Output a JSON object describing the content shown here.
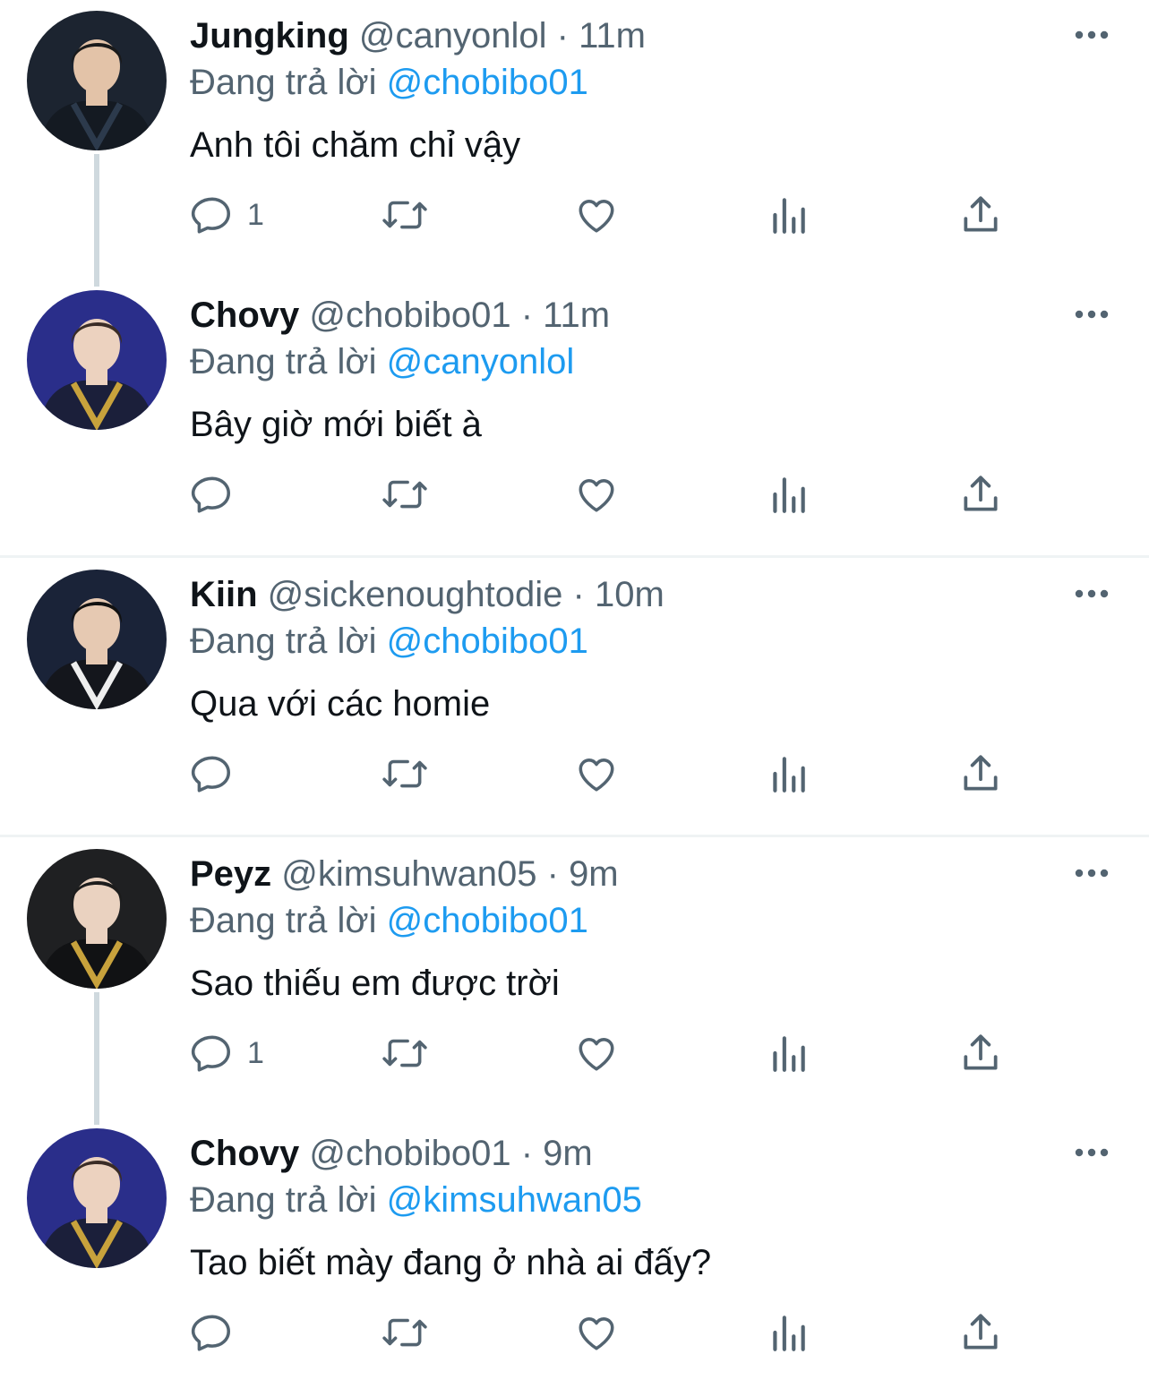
{
  "labels": {
    "replying_to": "Đang trả lời",
    "dot": "·"
  },
  "colors": {
    "mention": "#1d9bf0",
    "secondary": "#536471",
    "thread_line": "#cfd9de",
    "divider": "#eff3f4"
  },
  "icons": [
    "reply-icon",
    "retweet-icon",
    "like-icon",
    "views-icon",
    "share-icon",
    "more-icon"
  ],
  "tweets": [
    {
      "name": "Jungking",
      "handle": "@canyonlol",
      "time": "11m",
      "reply_to": "@chobibo01",
      "text": "Anh tôi chăm chỉ vậy",
      "reply_count": "1",
      "avatar": {
        "bg": "#1c2430",
        "jersey": "#141a22",
        "skin": "#e3c3a8",
        "hair": "#1a1a1a",
        "accent": "#2c3a4c"
      }
    },
    {
      "name": "Chovy",
      "handle": "@chobibo01",
      "time": "11m",
      "reply_to": "@canyonlol",
      "text": "Bây giờ mới biết à",
      "reply_count": "",
      "avatar": {
        "bg": "#2a2e8a",
        "jersey": "#1b1f3a",
        "skin": "#ecd2bf",
        "hair": "#3a2c26",
        "accent": "#c8a23c"
      }
    },
    {
      "name": "Kiin",
      "handle": "@sickenoughtodie",
      "time": "10m",
      "reply_to": "@chobibo01",
      "text": "Qua với các homie",
      "reply_count": "",
      "avatar": {
        "bg": "#1a2338",
        "jersey": "#14161c",
        "skin": "#e6c9b2",
        "hair": "#111111",
        "accent": "#eeeeee"
      }
    },
    {
      "name": "Peyz",
      "handle": "@kimsuhwan05",
      "time": "9m",
      "reply_to": "@chobibo01",
      "text": "Sao thiếu em được trời",
      "reply_count": "1",
      "avatar": {
        "bg": "#1f2022",
        "jersey": "#111214",
        "skin": "#ead2c0",
        "hair": "#1c1c1c",
        "accent": "#c8a23c"
      }
    },
    {
      "name": "Chovy",
      "handle": "@chobibo01",
      "time": "9m",
      "reply_to": "@kimsuhwan05",
      "text": "Tao biết mày đang ở nhà ai đấy?",
      "reply_count": "",
      "avatar": {
        "bg": "#2a2e8a",
        "jersey": "#1b1f3a",
        "skin": "#ecd2bf",
        "hair": "#3a2c26",
        "accent": "#c8a23c"
      }
    }
  ]
}
